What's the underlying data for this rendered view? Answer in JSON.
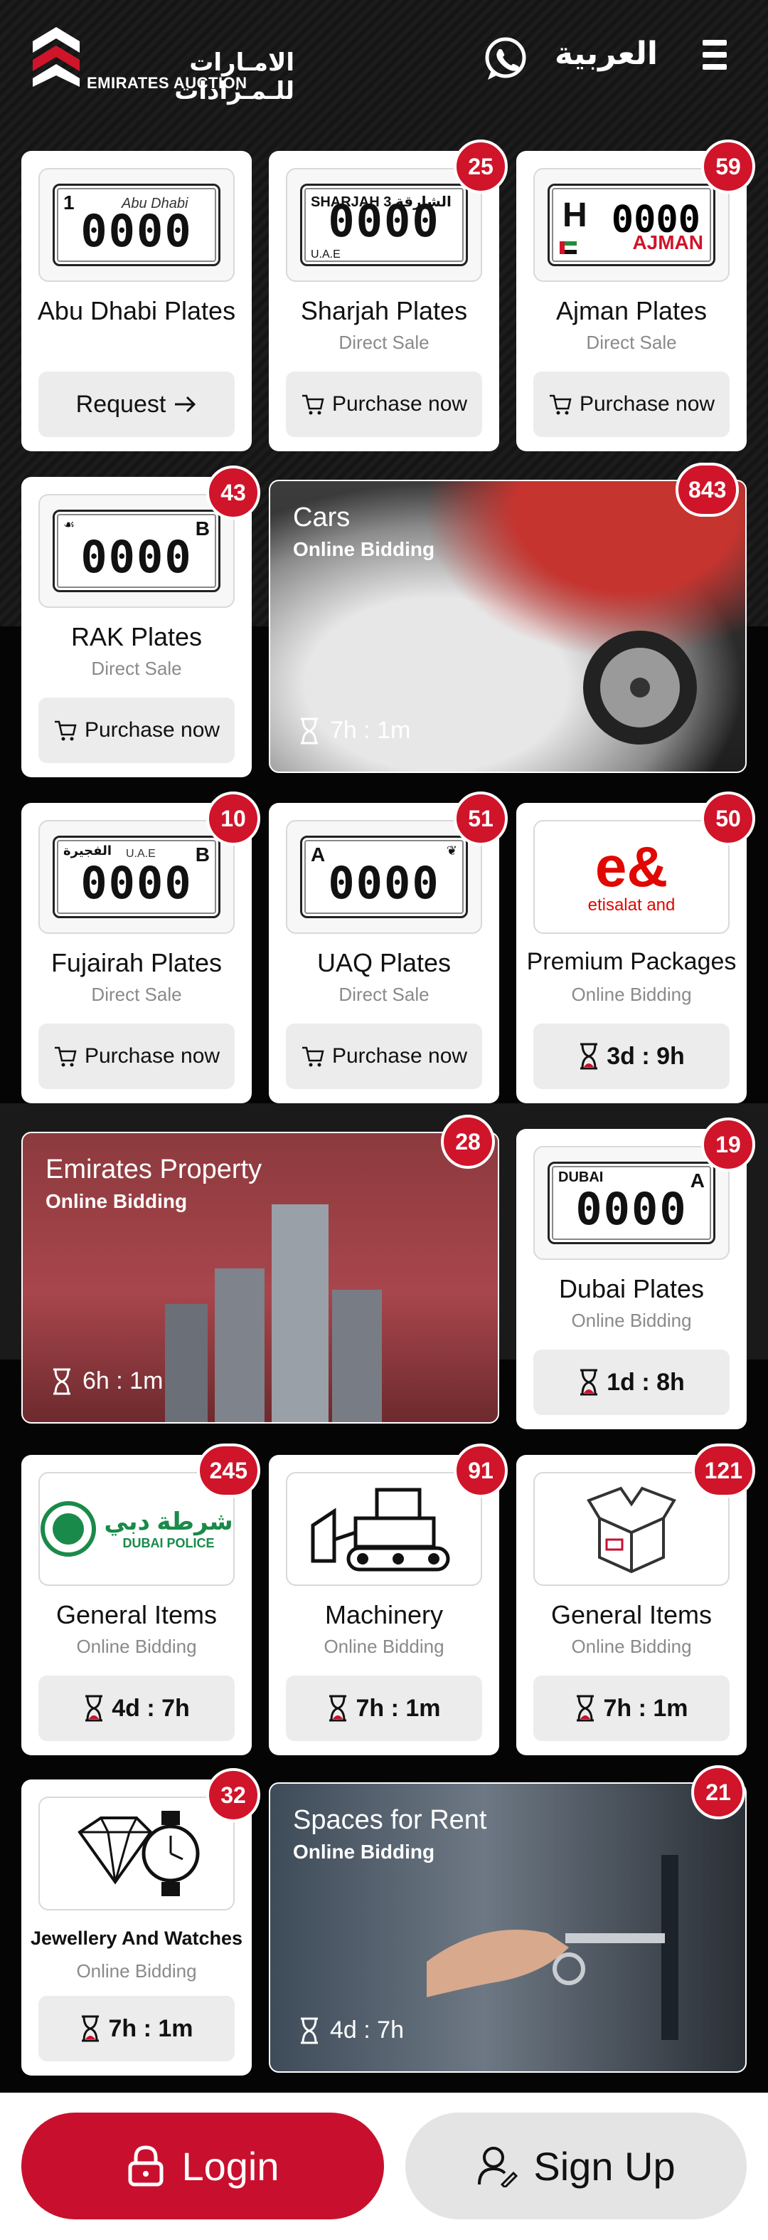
{
  "header": {
    "logo_ar": "الامـارات للـمـزادات",
    "logo_en": "EMIRATES AUCTION",
    "language": "العربية"
  },
  "colors": {
    "accent": "#d0142a",
    "login": "#c8102e"
  },
  "cards": {
    "abu_dhabi": {
      "title": "Abu Dhabi Plates",
      "button": "Request",
      "plate_code": "1",
      "plate_number": "0000",
      "plate_text": "Abu Dhabi"
    },
    "sharjah": {
      "title": "Sharjah Plates",
      "subtitle": "Direct Sale",
      "button": "Purchase now",
      "badge": "25",
      "plate_top": "SHARJAH 3 الشارقة",
      "plate_number": "0000",
      "plate_bottom": "U.A.E"
    },
    "ajman": {
      "title": "Ajman Plates",
      "subtitle": "Direct Sale",
      "button": "Purchase now",
      "badge": "59",
      "plate_code": "H",
      "plate_number": "0000",
      "plate_text": "AJMAN"
    },
    "rak": {
      "title": "RAK Plates",
      "subtitle": "Direct Sale",
      "button": "Purchase now",
      "badge": "43",
      "plate_code": "B",
      "plate_number": "0000"
    },
    "cars": {
      "title": "Cars",
      "subtitle": "Online Bidding",
      "timer": "7h : 1m",
      "badge": "843"
    },
    "fujairah": {
      "title": "Fujairah Plates",
      "subtitle": "Direct Sale",
      "button": "Purchase now",
      "badge": "10",
      "plate_code": "B",
      "plate_number": "0000",
      "plate_text": "U.A.E"
    },
    "uaq": {
      "title": "UAQ Plates",
      "subtitle": "Direct Sale",
      "button": "Purchase now",
      "badge": "51",
      "plate_code": "A",
      "plate_number": "0000"
    },
    "premium": {
      "title": "Premium Packages",
      "subtitle": "Online Bidding",
      "timer": "3d : 9h",
      "badge": "50",
      "logo_text": "etisalat and"
    },
    "property": {
      "title": "Emirates Property",
      "subtitle": "Online Bidding",
      "timer": "6h : 1m",
      "badge": "28"
    },
    "dubai": {
      "title": "Dubai Plates",
      "subtitle": "Online Bidding",
      "timer": "1d : 8h",
      "badge": "19",
      "plate_top": "DUBAI",
      "plate_code": "A",
      "plate_number": "0000"
    },
    "general_police": {
      "title": "General Items",
      "subtitle": "Online Bidding",
      "timer": "4d : 7h",
      "badge": "245",
      "logo_ar": "شرطة دبي",
      "logo_en": "DUBAI POLICE"
    },
    "machinery": {
      "title": "Machinery",
      "subtitle": "Online Bidding",
      "timer": "7h : 1m",
      "badge": "91"
    },
    "general_box": {
      "title": "General Items",
      "subtitle": "Online Bidding",
      "timer": "7h : 1m",
      "badge": "121"
    },
    "jewellery": {
      "title": "Jewellery And Watches",
      "subtitle": "Online Bidding",
      "timer": "7h : 1m",
      "badge": "32"
    },
    "spaces": {
      "title": "Spaces for Rent",
      "subtitle": "Online Bidding",
      "timer": "4d : 7h",
      "badge": "21"
    }
  },
  "footer": {
    "login": "Login",
    "signup": "Sign Up"
  }
}
